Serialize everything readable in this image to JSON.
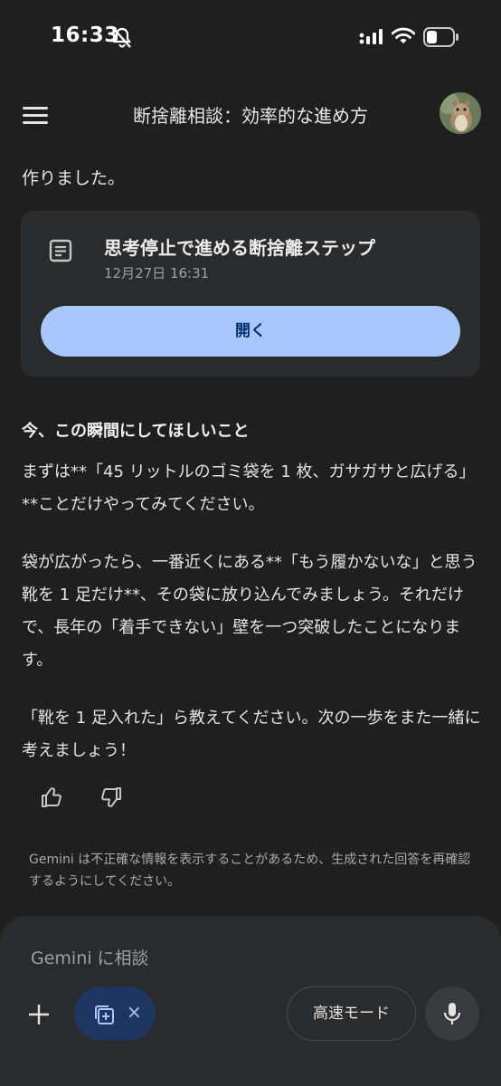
{
  "status_bar": {
    "time": "16:33",
    "icons": [
      "bell-off-icon",
      "signal-icon",
      "wifi-icon",
      "battery-icon"
    ]
  },
  "header": {
    "title": "断捨離相談：効率的な進め方"
  },
  "chat": {
    "intro": "作りました。",
    "doc_card": {
      "title": "思考停止で進める断捨離ステップ",
      "date": "12月27日 16:31",
      "open_label": "開く",
      "icon": "document-icon"
    },
    "section_heading": "今、この瞬間にしてほしいこと",
    "paragraphs": [
      "まずは**「45 リットルのゴミ袋を 1 枚、ガサガサと広げる」**ことだけやってみてください。",
      "袋が広がったら、一番近くにある**「もう履かないな」と思う靴を 1 足だけ**、その袋に放り込んでみましょう。それだけで、長年の「着手できない」壁を一つ突破したことになります。",
      "「靴を 1 足入れた」ら教えてください。次の一歩をまた一緒に考えましょう！"
    ],
    "feedback_icons": [
      "thumb-up-icon",
      "thumb-down-icon"
    ]
  },
  "disclaimer": "Gemini は不正確な情報を表示することがあるため、生成された回答を再確認するようにしてください。",
  "composer": {
    "placeholder": "Gemini に相談",
    "chip_close": "×",
    "mode_label": "高速モード"
  },
  "colors": {
    "background": "#1f1f1f",
    "card": "#2a2b2d",
    "button_primary": "#a8c7fa",
    "button_primary_text": "#062e6f",
    "chip": "#1f3760"
  }
}
